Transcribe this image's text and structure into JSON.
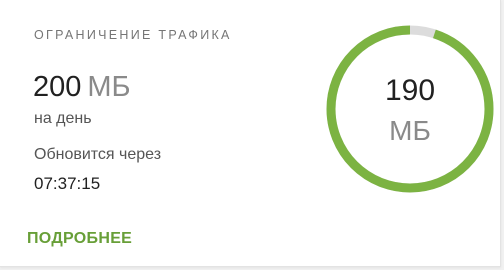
{
  "card": {
    "title": "ОГРАНИЧЕНИЕ ТРАФИКА",
    "limit_value": "200",
    "limit_unit": "МБ",
    "per_day": "на день",
    "renew_label": "Обновится через",
    "renew_time": "07:37:15",
    "more_label": "ПОДРОБНЕЕ"
  },
  "gauge": {
    "remaining_value": "190",
    "remaining_unit": "МБ",
    "remaining_fraction": 0.95
  },
  "colors": {
    "accent": "#7cb342",
    "track": "#dcdcdc",
    "link": "#689f38"
  }
}
